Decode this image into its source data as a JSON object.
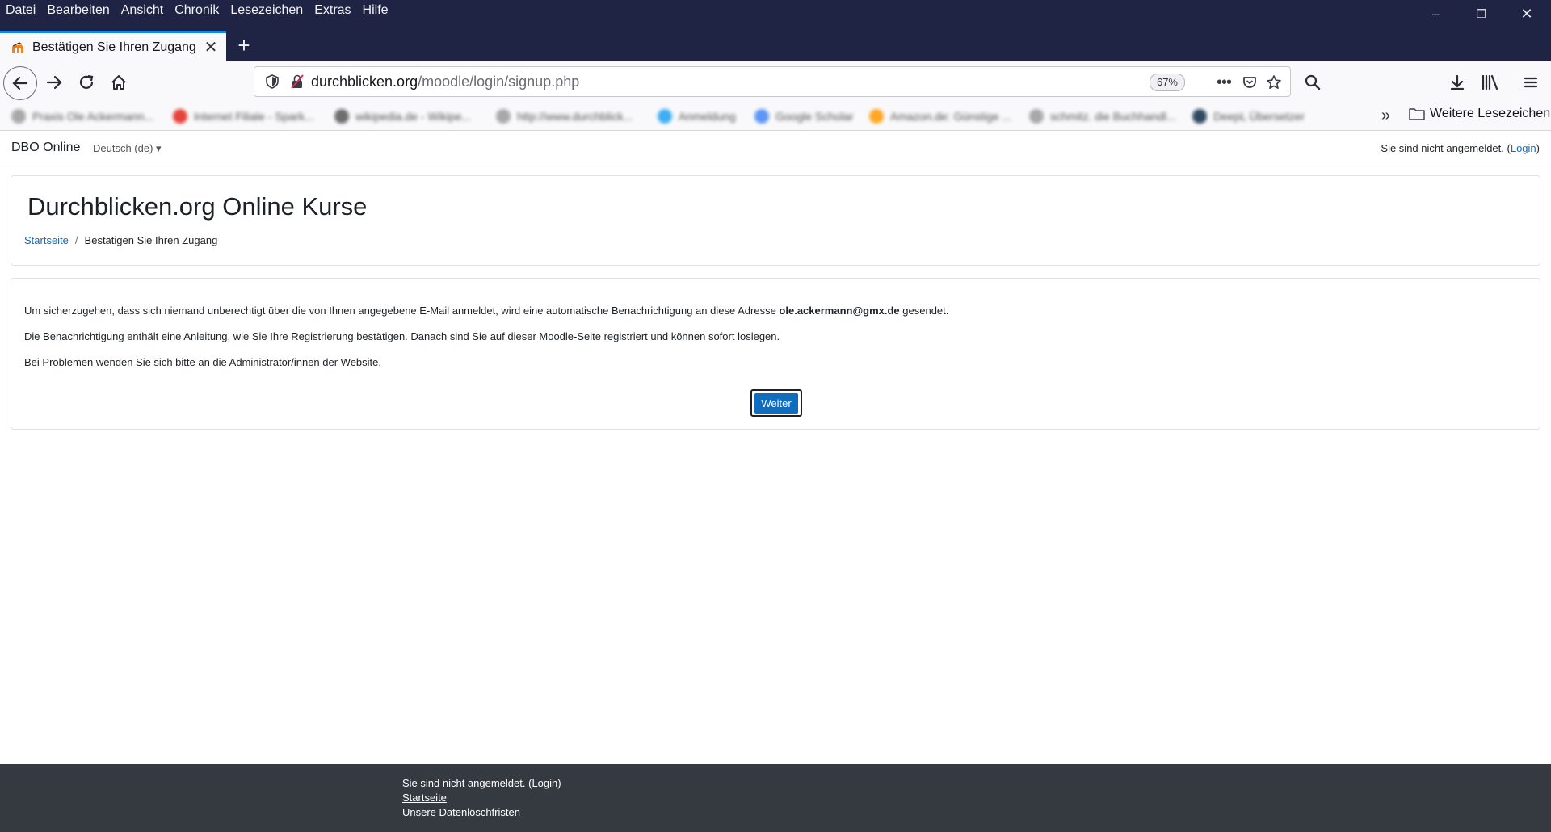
{
  "menubar": {
    "items": [
      "Datei",
      "Bearbeiten",
      "Ansicht",
      "Chronik",
      "Lesezeichen",
      "Extras",
      "Hilfe"
    ]
  },
  "window_controls": {
    "minimize": "–",
    "restore": "❐",
    "close": "✕"
  },
  "tab": {
    "title": "Bestätigen Sie Ihren Zugang",
    "close": "✕",
    "new_tab": "+"
  },
  "urlbar": {
    "host": "durchblicken.org",
    "path": "/moodle/login/signup.php",
    "zoom": "67%"
  },
  "bookmarks": {
    "items": [
      {
        "label": "Praxis Ole Ackermann...",
        "color": "#9a9a9a"
      },
      {
        "label": "Internet Filiale - Spark...",
        "color": "#e2231a"
      },
      {
        "label": "wikipedia.de - Wikipe...",
        "color": "#555555"
      },
      {
        "label": "http://www.durchblick...",
        "color": "#9a9a9a"
      },
      {
        "label": "Anmeldung",
        "color": "#1da1f2"
      },
      {
        "label": "Google Scholar",
        "color": "#4285f4"
      },
      {
        "label": "Amazon.de: Günstige ...",
        "color": "#ff9900"
      },
      {
        "label": "schmitz. die Buchhandl...",
        "color": "#9a9a9a"
      },
      {
        "label": "DeepL Übersetzer",
        "color": "#0f2b46"
      }
    ],
    "more": "»",
    "folder": "Weitere Lesezeichen"
  },
  "site": {
    "name": "DBO Online",
    "language": "Deutsch (de) ▾",
    "login_prefix": "Sie sind nicht angemeldet. (",
    "login_link": "Login",
    "login_suffix": ")"
  },
  "header": {
    "title": "Durchblicken.org Online Kurse",
    "breadcrumb_home": "Startseite",
    "breadcrumb_sep": "/",
    "breadcrumb_current": "Bestätigen Sie Ihren Zugang"
  },
  "content": {
    "p1_before": "Um sicherzugehen, dass sich niemand unberechtigt über die von Ihnen angegebene E-Mail anmeldet, wird eine automatische Benachrichtigung an diese Adresse ",
    "p1_email": "ole.ackermann@gmx.de",
    "p1_after": " gesendet.",
    "p2": "Die Benachrichtigung enthält eine Anleitung, wie Sie Ihre Registrierung bestätigen. Danach sind Sie auf dieser Moodle-Seite registriert und können sofort loslegen.",
    "p3": "Bei Problemen wenden Sie sich bitte an die Administrator/innen der Website.",
    "continue_button": "Weiter"
  },
  "footer": {
    "login_prefix": "Sie sind nicht angemeldet. (",
    "login_link": "Login",
    "login_suffix": ")",
    "home_link": "Startseite",
    "data_retention_link": "Unsere Datenlöschfristen"
  }
}
